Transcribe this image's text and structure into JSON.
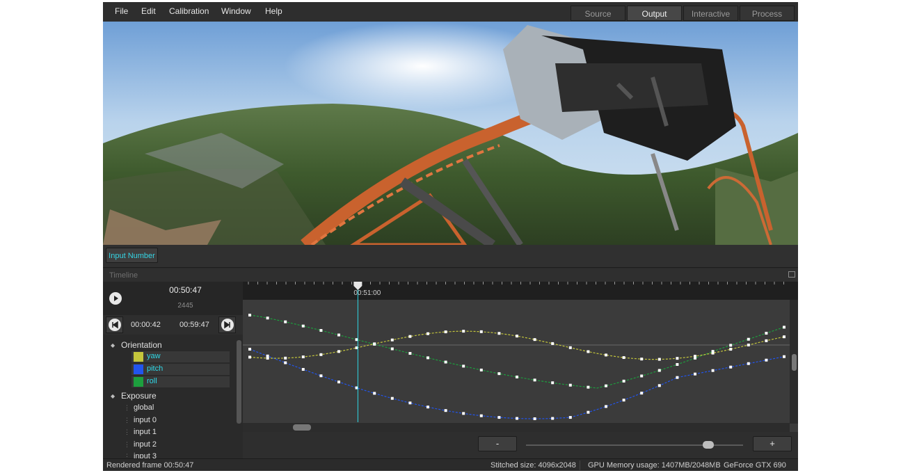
{
  "menu": [
    "File",
    "Edit",
    "Calibration",
    "Window",
    "Help"
  ],
  "tabs": [
    {
      "label": "Source",
      "active": false
    },
    {
      "label": "Output",
      "active": true
    },
    {
      "label": "Interactive",
      "active": false
    },
    {
      "label": "Process",
      "active": false
    }
  ],
  "input_number_button": "Input Number",
  "timeline": {
    "title": "Timeline",
    "current_time": "00:50:47",
    "current_frame": "2445",
    "range_start": "00:00:42",
    "range_end": "00:59:47",
    "ruler_marker": "00:51:00",
    "playhead_fraction": 0.21
  },
  "tree": {
    "orientation": {
      "label": "Orientation",
      "curves": [
        {
          "label": "yaw",
          "color": "#c4c63c"
        },
        {
          "label": "pitch",
          "color": "#2255ee"
        },
        {
          "label": "roll",
          "color": "#1d9f3e"
        }
      ]
    },
    "exposure": {
      "label": "Exposure",
      "items": [
        "global",
        "input 0",
        "input 1",
        "input 2",
        "input 3"
      ]
    }
  },
  "zoom": {
    "minus_label": "-",
    "plus_label": "+",
    "level": 0.84
  },
  "status": {
    "rendered": "Rendered frame 00:50:47",
    "stitched": "Stitched size: 4096x2048",
    "gpu_memory": "GPU Memory usage: 1407MB/2048MB",
    "gpu": "GeForce GTX 690"
  },
  "colors": {
    "accent": "#2fd9e8",
    "playhead": "#2fd9e8",
    "yaw": "#c4c63c",
    "pitch": "#2255ee",
    "roll": "#1d9f3e"
  }
}
